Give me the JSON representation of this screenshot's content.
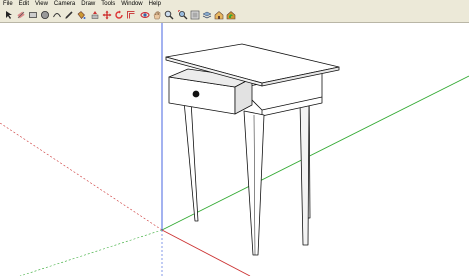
{
  "menus": [
    "File",
    "Edit",
    "View",
    "Camera",
    "Draw",
    "Tools",
    "Window",
    "Help"
  ],
  "tools": [
    {
      "name": "select-icon",
      "color": "#222222"
    },
    {
      "name": "eraser-icon",
      "color": "#cc6677"
    },
    {
      "name": "rectangle-icon",
      "color": "#666666"
    },
    {
      "name": "circle-icon",
      "color": "#555555"
    },
    {
      "name": "arc-icon",
      "color": "#444444"
    },
    {
      "name": "pencil-icon",
      "color": "#333333"
    },
    {
      "name": "paint-bucket-icon",
      "color": "#cc8833"
    },
    {
      "name": "push-pull-icon",
      "color": "#cc3333"
    },
    {
      "name": "move-icon",
      "color": "#cc2222"
    },
    {
      "name": "rotate-icon",
      "color": "#dd3333"
    },
    {
      "name": "offset-icon",
      "color": "#cc4444"
    },
    {
      "name": "orbit-icon",
      "color": "#cc2233"
    },
    {
      "name": "pan-icon",
      "color": "#aa6633"
    },
    {
      "name": "zoom-icon",
      "color": "#4466aa"
    },
    {
      "name": "zoom-extents-icon",
      "color": "#3366cc"
    },
    {
      "name": "components-icon",
      "color": "#888888"
    },
    {
      "name": "layers-icon",
      "color": "#6699cc"
    },
    {
      "name": "warehouse-icon",
      "color": "#cc9933"
    },
    {
      "name": "share-model-icon",
      "color": "#cc9933"
    }
  ],
  "axes": {
    "red": "#cc3333",
    "green": "#33aa33",
    "blue": "#3355dd"
  },
  "model": {
    "fill": "#ffffff",
    "edge": "#111111",
    "shade": "#e8e8e8",
    "knob": "#111111"
  }
}
